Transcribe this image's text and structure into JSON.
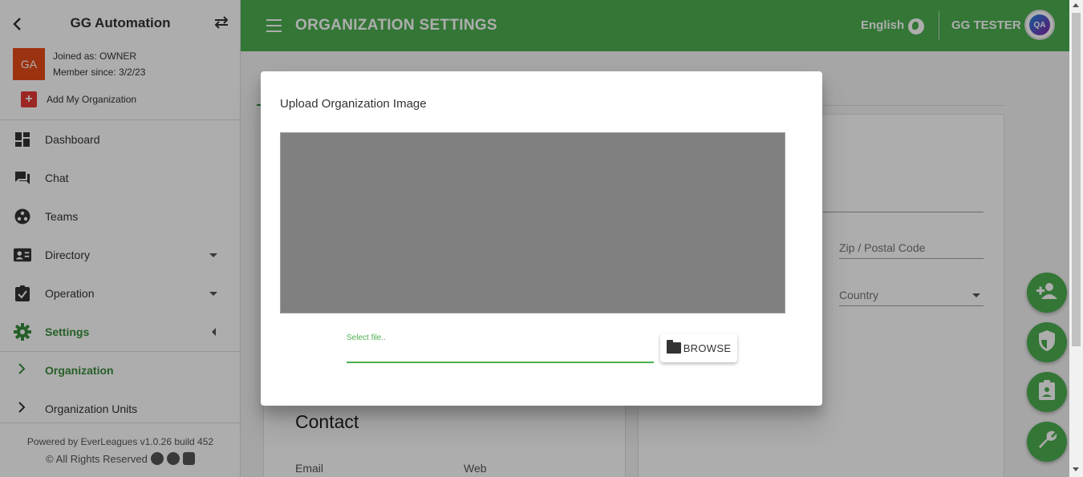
{
  "sidebar": {
    "title": "GG Automation",
    "avatar_initials": "GA",
    "role": "Joined as: OWNER",
    "member_since": "Member since: 3/2/23",
    "add_org": "Add My Organization",
    "items": [
      {
        "label": "Dashboard"
      },
      {
        "label": "Chat"
      },
      {
        "label": "Teams"
      },
      {
        "label": "Directory"
      },
      {
        "label": "Operation"
      },
      {
        "label": "Settings"
      }
    ],
    "sub_items": [
      {
        "label": "Organization"
      },
      {
        "label": "Organization Units"
      }
    ],
    "footer": {
      "powered": "Powered by EverLeagues v1.0.26 build 452",
      "rights": "© All Rights Reserved"
    }
  },
  "topbar": {
    "title": "ORGANIZATION SETTINGS",
    "language": "English",
    "user": "GG TESTER",
    "avatar_text": "QA"
  },
  "main": {
    "zip_label": "Zip / Postal Code",
    "country_label": "Country",
    "contact_heading": "Contact",
    "email_label": "Email",
    "web_label": "Web"
  },
  "dialog": {
    "title": "Upload Organization Image",
    "file_label": "Select file..",
    "file_value": "",
    "browse_label": "BROWSE"
  },
  "colors": {
    "primary": "#4caf50",
    "accent_text": "#388e3c",
    "avatar_bg": "#e64a19"
  }
}
